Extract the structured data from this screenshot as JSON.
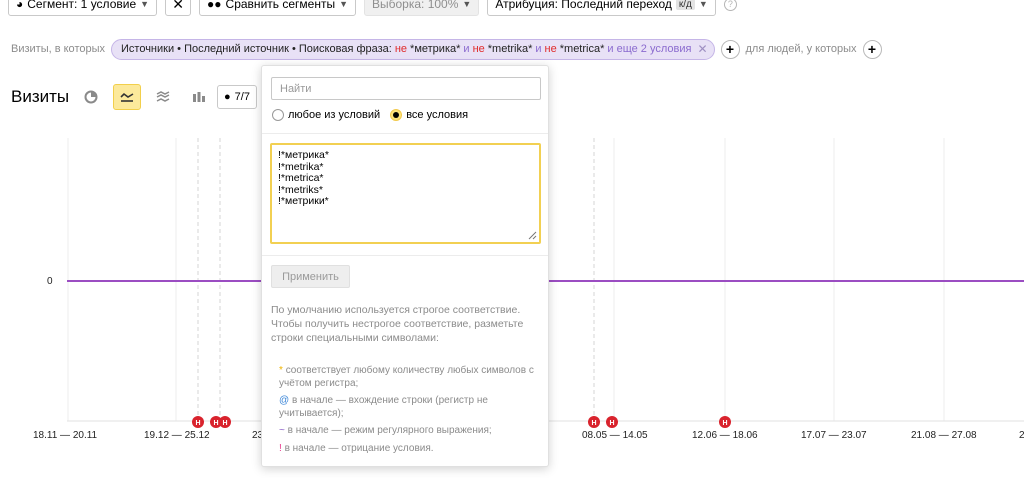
{
  "toolbar": {
    "segment_label": "Сегмент: 1 условие",
    "compare_label": "Сравнить сегменты",
    "sample_label": "Выборка: 100%",
    "attribution_label": "Атрибуция: Последний переход",
    "attribution_badge": "к/д"
  },
  "filter_line": {
    "visits_prefix": "Визиты, в которых",
    "chip_prefix": "Источники • Последний источник • Поисковая фраза:",
    "ne1": "не",
    "term1": "*метрика*",
    "and1": "и",
    "ne2": "не",
    "term2": "*metrika*",
    "and2": "и",
    "ne3": "не",
    "term3": "*metrica*",
    "more": "и еще 2 условия",
    "people_label": "для людей, у которых"
  },
  "chart_header": {
    "title": "Визиты",
    "comments_count": "7/7"
  },
  "chart_data": {
    "type": "line",
    "x_labels": [
      "18.11 — 20.11",
      "19.12 — 25.12",
      "23",
      "08.05 — 14.05",
      "12.06 — 18.06",
      "17.07 — 23.07",
      "21.08 — 27.08",
      "2"
    ],
    "y_tick": "0",
    "series": [
      {
        "values": [
          0,
          0,
          0,
          0,
          0,
          0,
          0,
          0
        ]
      }
    ],
    "series_color": "#9b4dc2",
    "annotation_marker": "Н"
  },
  "popup": {
    "search_placeholder": "Найти",
    "radio_any": "любое из условий",
    "radio_all": "все условия",
    "lines": [
      "!*метрика*",
      "!*metrika*",
      "!*metrica*",
      "!*metriks*",
      "!*метрики*"
    ],
    "apply_label": "Применить",
    "help_text": "По умолчанию используется строгое соответствие. Чтобы получить нестрогое соответствие, разметьте строки специальными символами:",
    "legend": {
      "star_symbol": "*",
      "star_text": "соответствует любому количеству любых символов с учётом регистра;",
      "at_symbol": "@",
      "at_text": "в начале — вхождение строки (регистр не учитывается);",
      "tilde_symbol": "~",
      "tilde_text": "в начале — режим регулярного выражения;",
      "bang_symbol": "!",
      "bang_text": "в начале — отрицание условия."
    }
  }
}
